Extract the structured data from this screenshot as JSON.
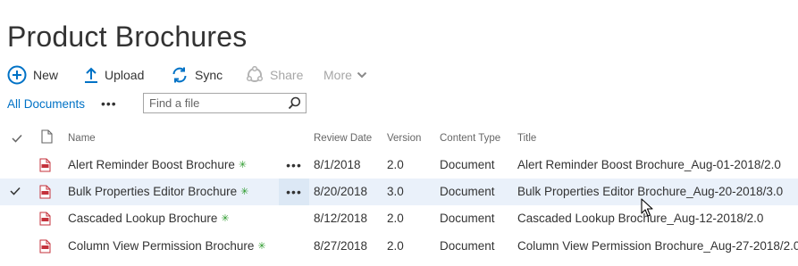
{
  "page_title": "Product Brochures",
  "commands": {
    "new": "New",
    "upload": "Upload",
    "sync": "Sync",
    "share": "Share",
    "more": "More"
  },
  "view": {
    "current": "All Documents",
    "options": "•••"
  },
  "search": {
    "placeholder": "Find a file",
    "value": ""
  },
  "columns": {
    "name": "Name",
    "review_date": "Review Date",
    "version": "Version",
    "content_type": "Content Type",
    "title": "Title"
  },
  "row_menu": "•••",
  "new_marker": "✳",
  "rows": [
    {
      "name": "Alert Reminder Boost Brochure",
      "review_date": "8/1/2018",
      "version": "2.0",
      "content_type": "Document",
      "title": "Alert Reminder Boost Brochure_Aug-01-2018/2.0",
      "selected": false
    },
    {
      "name": "Bulk Properties Editor Brochure",
      "review_date": "8/20/2018",
      "version": "3.0",
      "content_type": "Document",
      "title": "Bulk Properties Editor Brochure_Aug-20-2018/3.0",
      "selected": true
    },
    {
      "name": "Cascaded Lookup Brochure",
      "review_date": "8/12/2018",
      "version": "2.0",
      "content_type": "Document",
      "title": "Cascaded Lookup Brochure_Aug-12-2018/2.0",
      "selected": false
    },
    {
      "name": "Column View Permission Brochure",
      "review_date": "8/27/2018",
      "version": "2.0",
      "content_type": "Document",
      "title": "Column View Permission Brochure_Aug-27-2018/2.0",
      "selected": false
    }
  ],
  "icons": {
    "new": "plus-circle-icon",
    "upload": "upload-arrow-icon",
    "sync": "sync-icon",
    "share": "share-icon",
    "more": "chevron-down-icon",
    "search": "search-icon",
    "file_type": "pdf-file-icon",
    "check": "check-icon",
    "doc_header": "document-icon"
  },
  "colors": {
    "accent": "#0072c6",
    "selected_row": "#eaf1fa",
    "new_marker": "#2b9a2b",
    "pdf_red": "#c4313b",
    "disabled": "#a6a6a6"
  }
}
